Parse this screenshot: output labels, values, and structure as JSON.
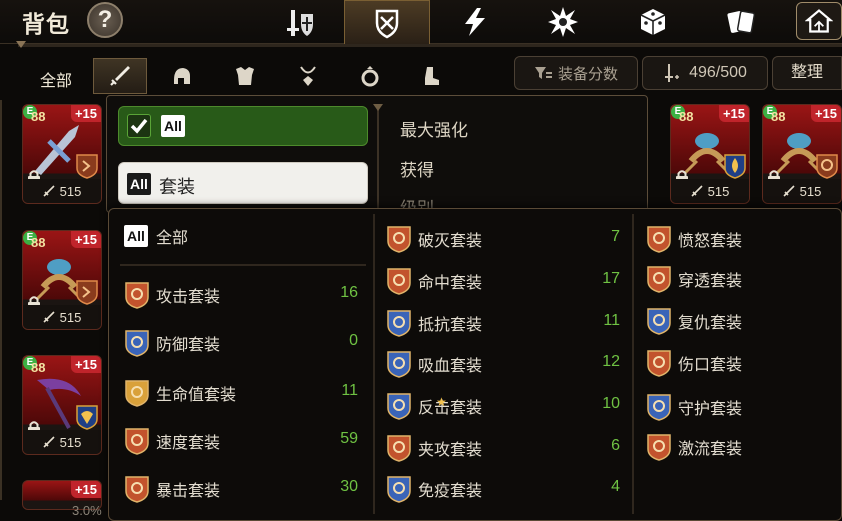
{
  "header": {
    "title": "背包",
    "help": "?",
    "tabs": [
      {
        "icon": "sword-shield-icon"
      },
      {
        "icon": "armor-shield-icon",
        "active": true
      },
      {
        "icon": "lightning-icon"
      },
      {
        "icon": "burst-icon"
      },
      {
        "icon": "dice-icon"
      },
      {
        "icon": "cards-icon"
      },
      {
        "icon": "home-icon"
      }
    ]
  },
  "filter": {
    "all_label": "全部",
    "equipment_tabs": [
      "sword-icon",
      "helmet-icon",
      "chestplate-icon",
      "amulet-icon",
      "ring-icon",
      "boots-icon"
    ],
    "score_label": "装备分数",
    "capacity": "496/500",
    "sort_label": "整理"
  },
  "slots": [
    {
      "level": "88",
      "plus": "+15",
      "grade": "E",
      "attack": "515"
    },
    {
      "level": "88",
      "plus": "+15",
      "grade": "E",
      "attack": "515"
    },
    {
      "level": "88",
      "plus": "+15",
      "grade": "E",
      "attack": "515"
    },
    {
      "level": "88",
      "plus": "+15",
      "grade": "E",
      "attack": "515"
    },
    {
      "level": "88",
      "plus": "+15",
      "grade": "E",
      "attack": "515"
    },
    {
      "plus": "+15"
    }
  ],
  "bottom_text": "3.0%",
  "sort_panel": {
    "all_label": "All",
    "set_all_badge": "All",
    "set_label": "套装",
    "options": [
      "最大强化",
      "获得",
      "级别"
    ]
  },
  "set_panel": {
    "all_badge": "All",
    "all_label": "全部",
    "col1": [
      {
        "name": "攻击套装",
        "count": "16",
        "color": "#c2532d"
      },
      {
        "name": "防御套装",
        "count": "0",
        "color": "#3a64b8"
      },
      {
        "name": "生命值套装",
        "count": "11",
        "color": "#d9a13a"
      },
      {
        "name": "速度套装",
        "count": "59",
        "color": "#c2532d"
      },
      {
        "name": "暴击套装",
        "count": "30",
        "color": "#c2532d"
      }
    ],
    "col2": [
      {
        "name": "破灭套装",
        "count": "7",
        "color": "#c2532d"
      },
      {
        "name": "命中套装",
        "count": "17",
        "color": "#c2532d"
      },
      {
        "name": "抵抗套装",
        "count": "11",
        "color": "#3a64b8"
      },
      {
        "name": "吸血套装",
        "count": "12",
        "color": "#3a64b8"
      },
      {
        "name": "反击套装",
        "count": "10",
        "color": "#3a64b8"
      },
      {
        "name": "夹攻套装",
        "count": "6",
        "color": "#c2532d"
      },
      {
        "name": "免疫套装",
        "count": "4",
        "color": "#3a64b8"
      }
    ],
    "col3": [
      {
        "name": "愤怒套装",
        "color": "#c2532d"
      },
      {
        "name": "穿透套装",
        "color": "#c2532d"
      },
      {
        "name": "复仇套装",
        "color": "#3a64b8"
      },
      {
        "name": "伤口套装",
        "color": "#c2532d"
      },
      {
        "name": "守护套装",
        "color": "#3a64b8"
      },
      {
        "name": "激流套装",
        "color": "#c2532d"
      }
    ]
  }
}
